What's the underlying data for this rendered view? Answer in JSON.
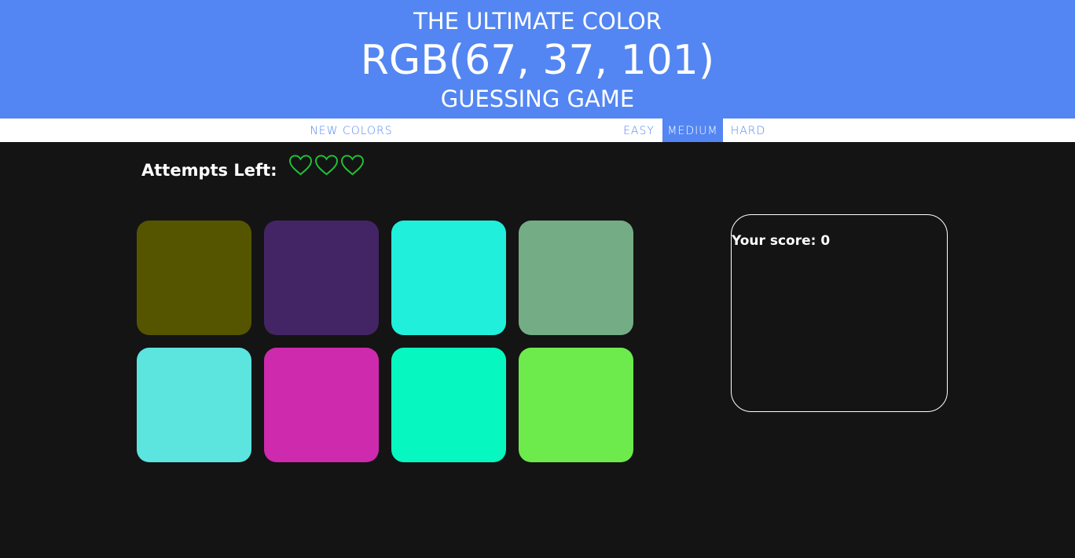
{
  "header": {
    "title_top": "THE ULTIMATE COLOR",
    "rgb_display": "RGB(67, 37, 101)",
    "title_bottom": "GUESSING GAME",
    "background": "#5386f2"
  },
  "nav": {
    "new_colors": "NEW COLORS",
    "modes": [
      "EASY",
      "MEDIUM",
      "HARD"
    ],
    "selected_mode": "MEDIUM"
  },
  "attempts": {
    "label": "Attempts Left:",
    "hearts": [
      "heart-outline-icon",
      "heart-outline-icon",
      "heart-outline-icon"
    ],
    "count": 3,
    "heart_color": "#1fc436"
  },
  "squares": [
    "#555500",
    "#432565",
    "#20efdb",
    "#74ad85",
    "#5ce4df",
    "#cd2aad",
    "#06f7bf",
    "#6deb4c"
  ],
  "score": {
    "text": "Your score: 0"
  }
}
